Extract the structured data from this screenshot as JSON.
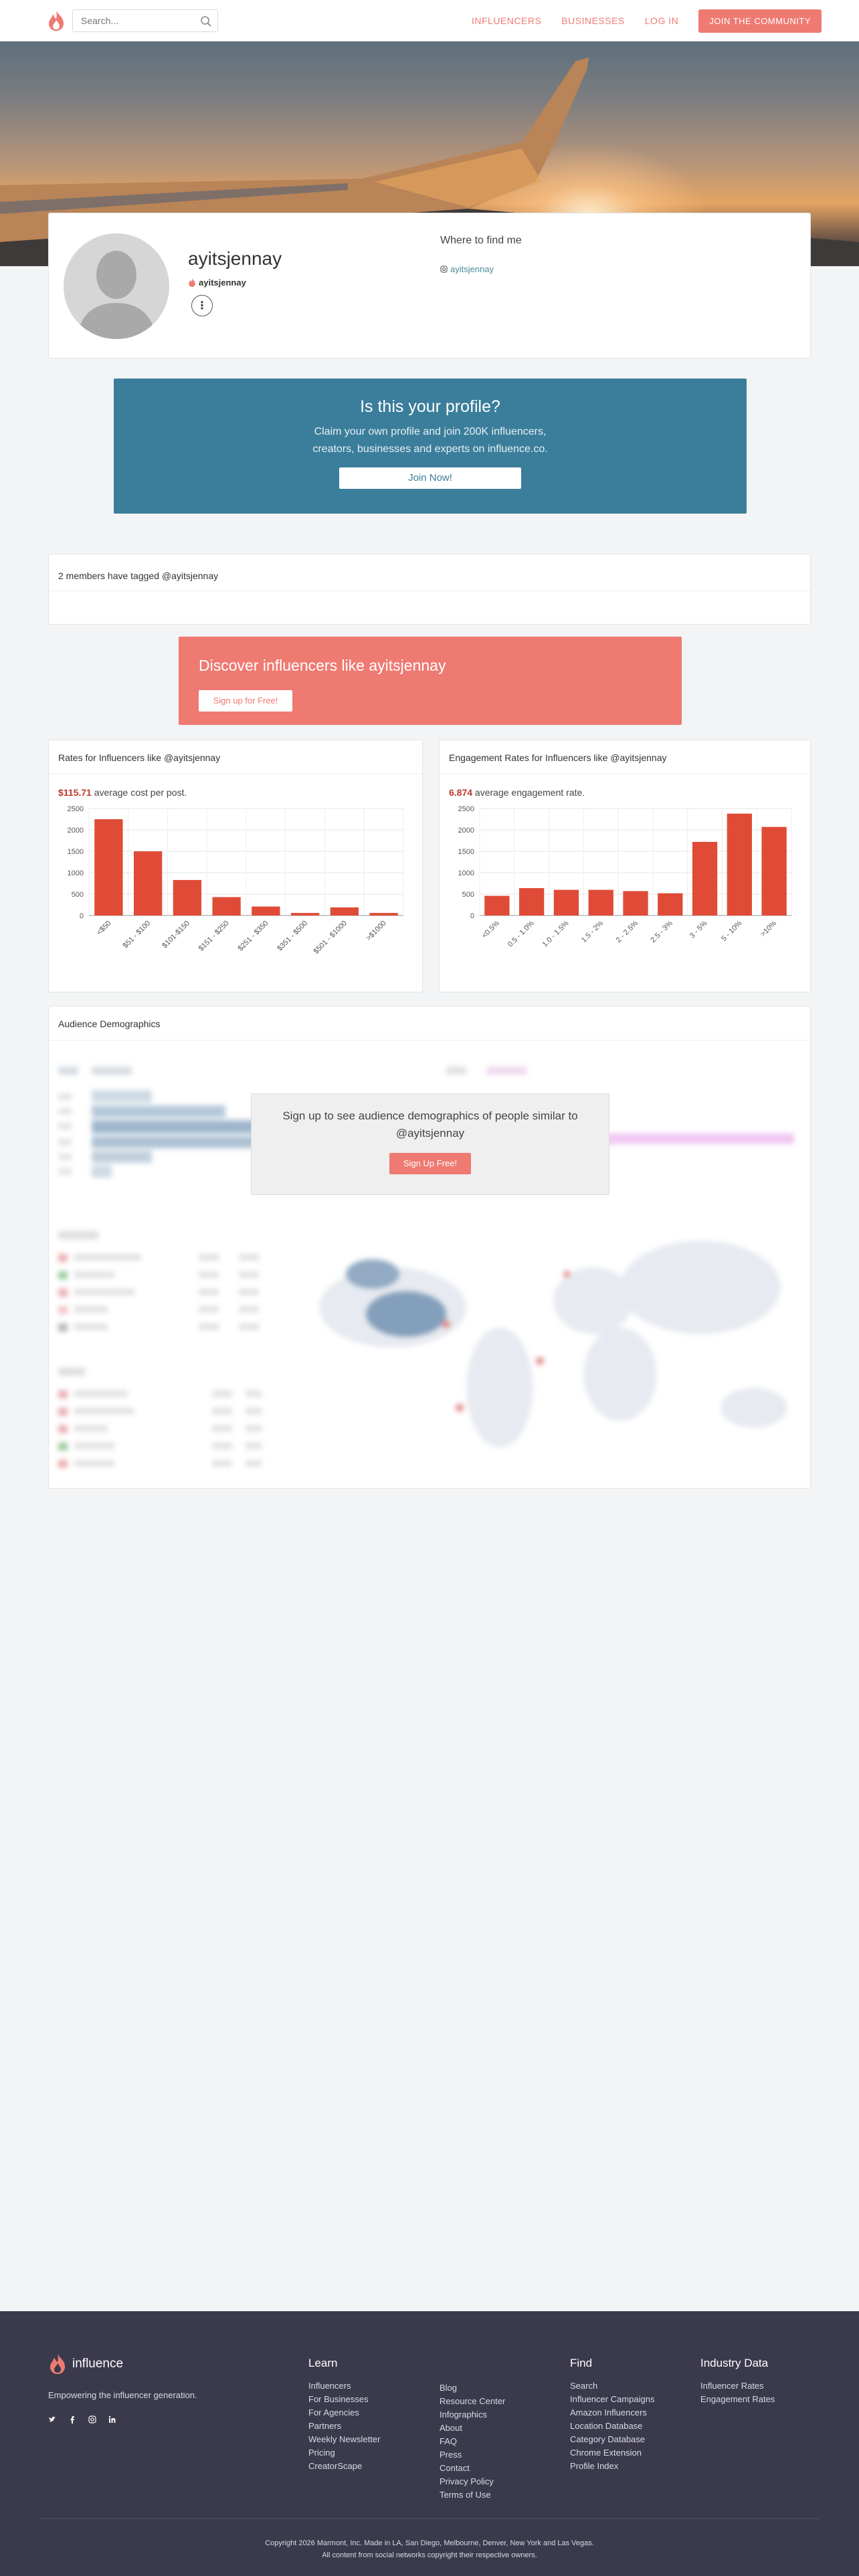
{
  "header": {
    "search_placeholder": "Search...",
    "nav": [
      "INFLUENCERS",
      "BUSINESSES",
      "LOG IN"
    ],
    "cta": "JOIN THE COMMUNITY",
    "brand_color": "#ee7a72"
  },
  "profile": {
    "name": "ayitsjennay",
    "handle": "ayitsjennay",
    "where_title": "Where to find me",
    "instagram": "ayitsjennay"
  },
  "claim": {
    "title": "Is this your profile?",
    "line1": "Claim your own profile and join 200K influencers,",
    "line2": "creators, businesses and experts on influence.co.",
    "button": "Join Now!"
  },
  "tagged": {
    "title": "2 members have tagged @ayitsjennay"
  },
  "discover": {
    "title": "Discover influencers like ayitsjennay",
    "button": "Sign up for Free!"
  },
  "rates": {
    "title": "Rates for Influencers like @ayitsjennay",
    "value": "$115.71",
    "suffix": " average cost per post.",
    "chart_data": {
      "type": "bar",
      "categories": [
        "<$50",
        "$51 - $100",
        "$101-$150",
        "$151 - $250",
        "$251 - $350",
        "$351 - $500",
        "$501 - $1000",
        ">$1000"
      ],
      "values": [
        2250,
        1500,
        830,
        430,
        210,
        60,
        190,
        60
      ],
      "ylim": [
        0,
        2500
      ],
      "yticks": [
        0,
        500,
        1000,
        1500,
        2000,
        2500
      ],
      "color": "#e04b37"
    }
  },
  "engagement": {
    "title": "Engagement Rates for Influencers like @ayitsjennay",
    "value": "6.874",
    "suffix": " average engagement rate.",
    "chart_data": {
      "type": "bar",
      "categories": [
        "<0.5%",
        "0.5 - 1.0%",
        "1.0 - 1.5%",
        "1.5 - 2%",
        "2 - 2.5%",
        "2.5 - 3%",
        "3 - 5%",
        "5 - 10%",
        ">10%"
      ],
      "values": [
        460,
        640,
        600,
        600,
        570,
        520,
        1720,
        2380,
        2070
      ],
      "ylim": [
        0,
        2500
      ],
      "yticks": [
        0,
        500,
        1000,
        1500,
        2000,
        2500
      ],
      "color": "#e04b37"
    }
  },
  "demographics": {
    "title": "Audience Demographics",
    "signup_line1": "Sign up to see audience demographics of people similar to",
    "signup_line2": "@ayitsjennay",
    "signup_button": "Sign Up Free!"
  },
  "footer": {
    "brand": "influence",
    "tagline": "Empowering the influencer generation.",
    "learn_title": "Learn",
    "learn": [
      "Influencers",
      "For Businesses",
      "For Agencies",
      "Partners",
      "Weekly Newsletter",
      "Pricing",
      "CreatorScape"
    ],
    "more": [
      "Blog",
      "Resource Center",
      "Infographics",
      "About",
      "FAQ",
      "Press",
      "Contact",
      "Privacy Policy",
      "Terms of Use"
    ],
    "find_title": "Find",
    "find": [
      "Search",
      "Influencer Campaigns",
      "Amazon Influencers",
      "Location Database",
      "Category Database",
      "Chrome Extension",
      "Profile Index"
    ],
    "industry_title": "Industry Data",
    "industry": [
      "Influencer Rates",
      "Engagement Rates"
    ],
    "copy1": "Copyright 2026 Marmont, Inc. Made in LA, San Diego, Melbourne, Denver, New York and Las Vegas.",
    "copy2": "All content from social networks copyright their respective owners."
  }
}
